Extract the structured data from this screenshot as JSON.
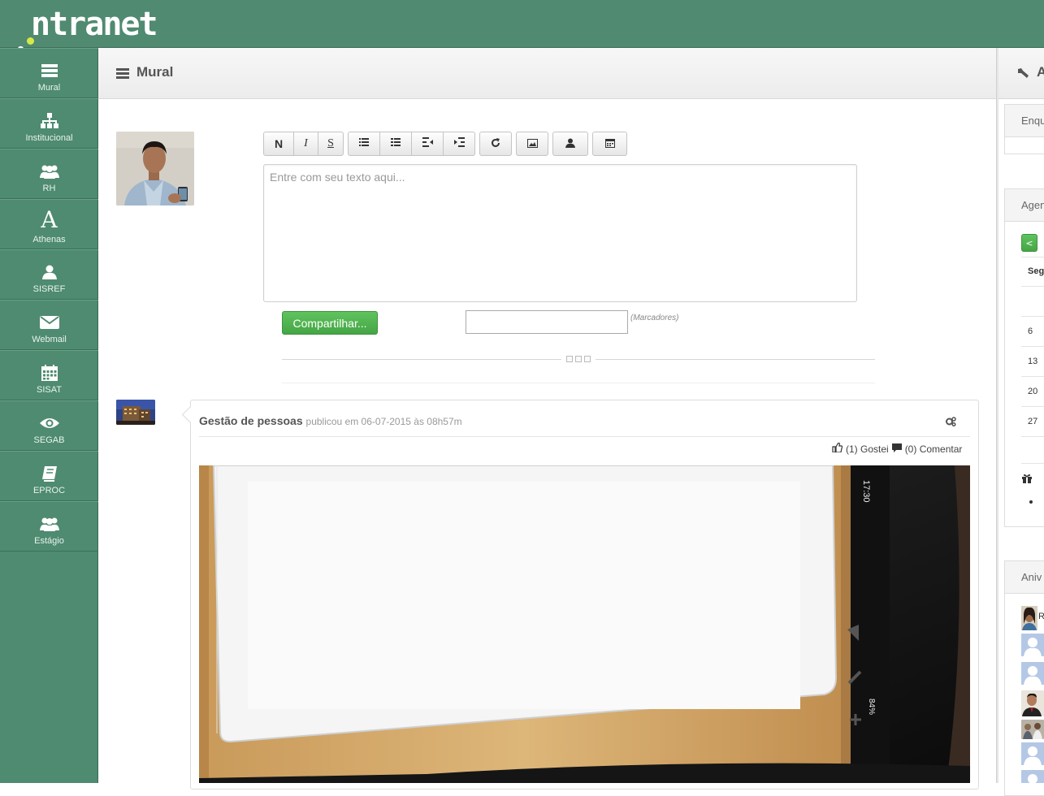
{
  "brand": {
    "logo_text": "ntranet"
  },
  "sidebar": {
    "items": [
      {
        "label": "Mural",
        "icon": "list-icon"
      },
      {
        "label": "Institucional",
        "icon": "sitemap-icon"
      },
      {
        "label": "RH",
        "icon": "group-icon"
      },
      {
        "label": "Athenas",
        "icon": "font-icon"
      },
      {
        "label": "SISREF",
        "icon": "user-icon"
      },
      {
        "label": "Webmail",
        "icon": "envelope-icon"
      },
      {
        "label": "SISAT",
        "icon": "calendar-icon"
      },
      {
        "label": "SEGAB",
        "icon": "eye-icon"
      },
      {
        "label": "EPROC",
        "icon": "book-icon"
      },
      {
        "label": "Estágio",
        "icon": "group-icon"
      }
    ]
  },
  "main": {
    "title": "Mural",
    "composer": {
      "format_buttons": [
        "N",
        "I",
        "S"
      ],
      "placeholder": "Entre com seu texto aqui...",
      "share_label": "Compartilhar...",
      "tags_hint": "(Marcadores)"
    },
    "post": {
      "author": "Gestão de pessoas",
      "meta": "publicou em 06-07-2015 às 08h57m",
      "likes": "(1) Gostei",
      "comments": "(0) Comentar",
      "image_texts": {
        "time": "17:30",
        "battery": "84%"
      }
    }
  },
  "right": {
    "header_letter": "A",
    "panels": {
      "poll": "Enqu",
      "agenda": "Agen",
      "birthdays": "Aniv"
    },
    "calendar": {
      "prev": "<",
      "day_header": "Seg",
      "days": [
        "6",
        "13",
        "20",
        "27"
      ]
    },
    "birthday_first_initial": "R"
  },
  "colors": {
    "brand_green": "#508a70",
    "button_green": "#4cb04b"
  }
}
